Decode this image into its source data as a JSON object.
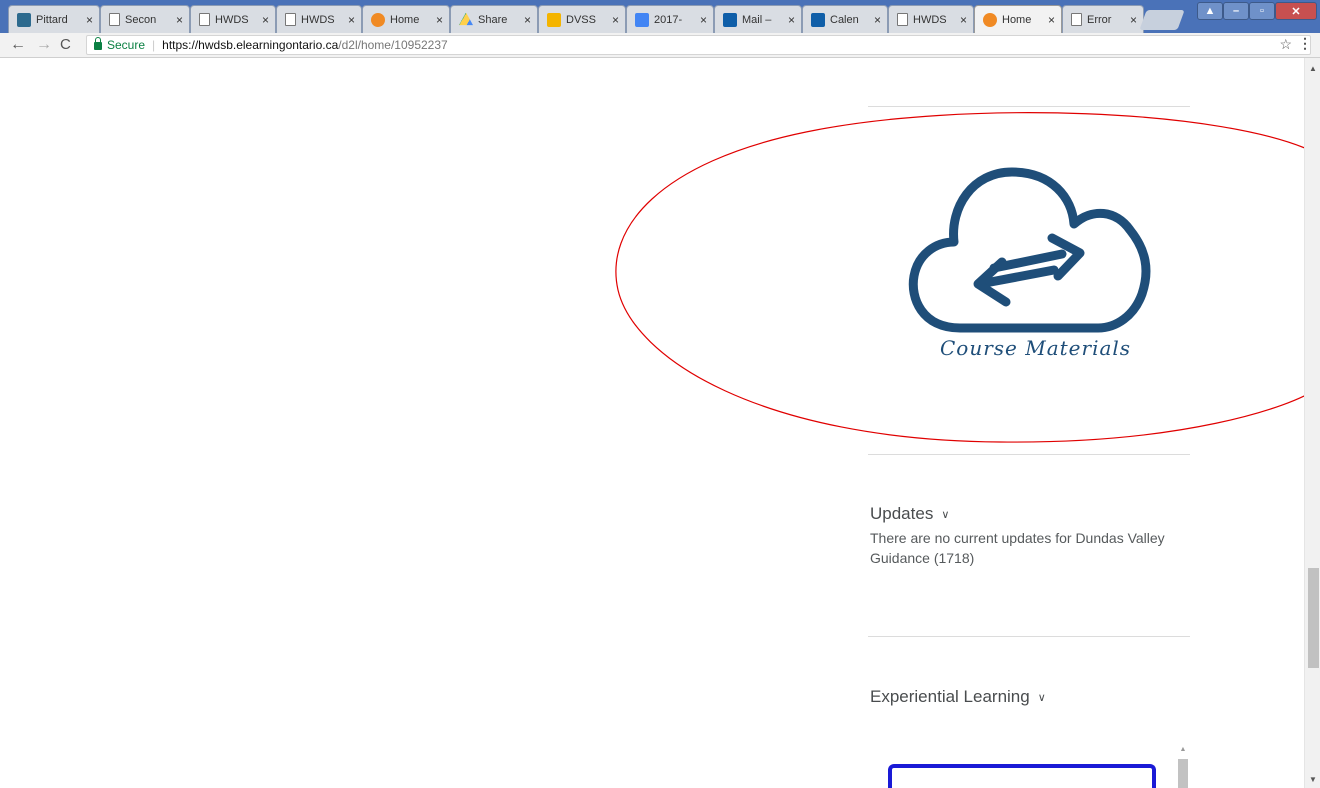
{
  "tabs": [
    {
      "label": "Pittard",
      "icon": "pinterest-icon",
      "active": false
    },
    {
      "label": "Secon",
      "icon": "page-icon",
      "active": false
    },
    {
      "label": "HWDS",
      "icon": "page-icon",
      "active": false
    },
    {
      "label": "HWDS",
      "icon": "page-icon",
      "active": false
    },
    {
      "label": "Home",
      "icon": "brightspace-icon",
      "active": false
    },
    {
      "label": "Share",
      "icon": "drive-icon",
      "active": false
    },
    {
      "label": "DVSS",
      "icon": "slides-icon",
      "active": false
    },
    {
      "label": "2017-",
      "icon": "docs-icon",
      "active": false
    },
    {
      "label": "Mail –",
      "icon": "outlook-icon",
      "active": false
    },
    {
      "label": "Calen",
      "icon": "outlook-icon",
      "active": false
    },
    {
      "label": "HWDS",
      "icon": "page-icon",
      "active": false
    },
    {
      "label": "Home",
      "icon": "brightspace-icon",
      "active": true
    },
    {
      "label": "Error",
      "icon": "page-icon",
      "active": false
    }
  ],
  "tab_close": "×",
  "toolbar": {
    "back": "←",
    "forward": "→",
    "reload": "C",
    "secure_label": "Secure",
    "url_host": "https://hwdsb.elearningontario.ca",
    "url_path": "/d2l/home/10952237",
    "star": "☆",
    "menu": "⋮"
  },
  "widgets": {
    "course_materials_label": "Course Materials",
    "updates_title": "Updates",
    "updates_text": "There are no current updates for Dundas Valley Guidance (1718)",
    "experiential_title": "Experiential Learning",
    "chevron": "⌄"
  },
  "colors": {
    "cloud": "#1f4e79",
    "annotation_ellipse": "#e00000",
    "iframe_border": "#1a1ad6"
  }
}
